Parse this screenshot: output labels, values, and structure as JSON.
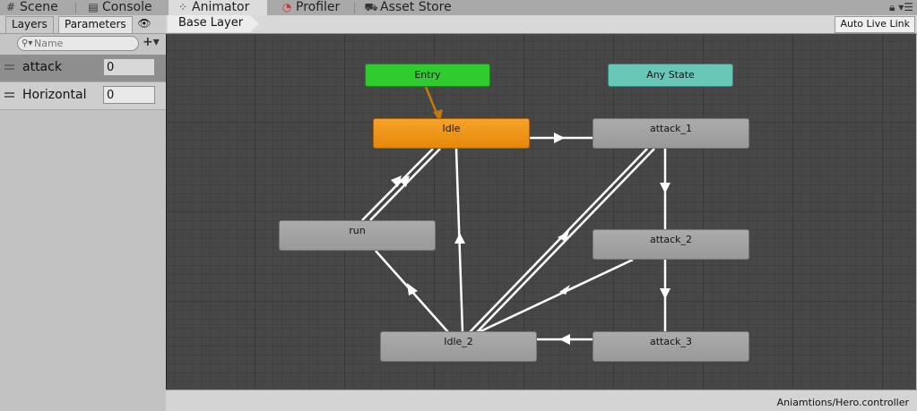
{
  "top_tabs": [
    {
      "label": "Scene",
      "icon": "grid-icon"
    },
    {
      "label": "Console",
      "icon": "console-icon"
    },
    {
      "label": "Animator",
      "icon": "animator-icon",
      "active": true
    },
    {
      "label": "Profiler",
      "icon": "profiler-icon"
    },
    {
      "label": "Asset Store",
      "icon": "store-icon"
    }
  ],
  "window_icons": {
    "lock": "lock-icon",
    "menu": "menu-icon"
  },
  "left_panel": {
    "tabs": [
      {
        "label": "Layers"
      },
      {
        "label": "Parameters",
        "active": true
      }
    ],
    "eye_icon": "eye-icon",
    "search": {
      "value": "",
      "placeholder": "Name",
      "icon": "search-icon"
    },
    "add_icon": "plus-icon",
    "parameters": [
      {
        "name": "attack",
        "value": "0",
        "selected": true
      },
      {
        "name": "Horizontal",
        "value": "0",
        "selected": false
      }
    ]
  },
  "graph": {
    "breadcrumb": "Base Layer",
    "auto_live_link": "Auto Live Link",
    "states": {
      "entry": "Entry",
      "any_state": "Any State",
      "idle": "Idle",
      "attack_1": "attack_1",
      "run": "run",
      "attack_2": "attack_2",
      "idle_2": "Idle_2",
      "attack_3": "attack_3"
    },
    "colors": {
      "entry": "#2fcb2f",
      "any_state": "#69c7b8",
      "default_state": "#f39a1c",
      "state": "#a3a3a3",
      "default_transition": "#c07a10",
      "transition": "#ffffff"
    }
  },
  "footer": {
    "path": "Aniamtions/Hero.controller"
  }
}
